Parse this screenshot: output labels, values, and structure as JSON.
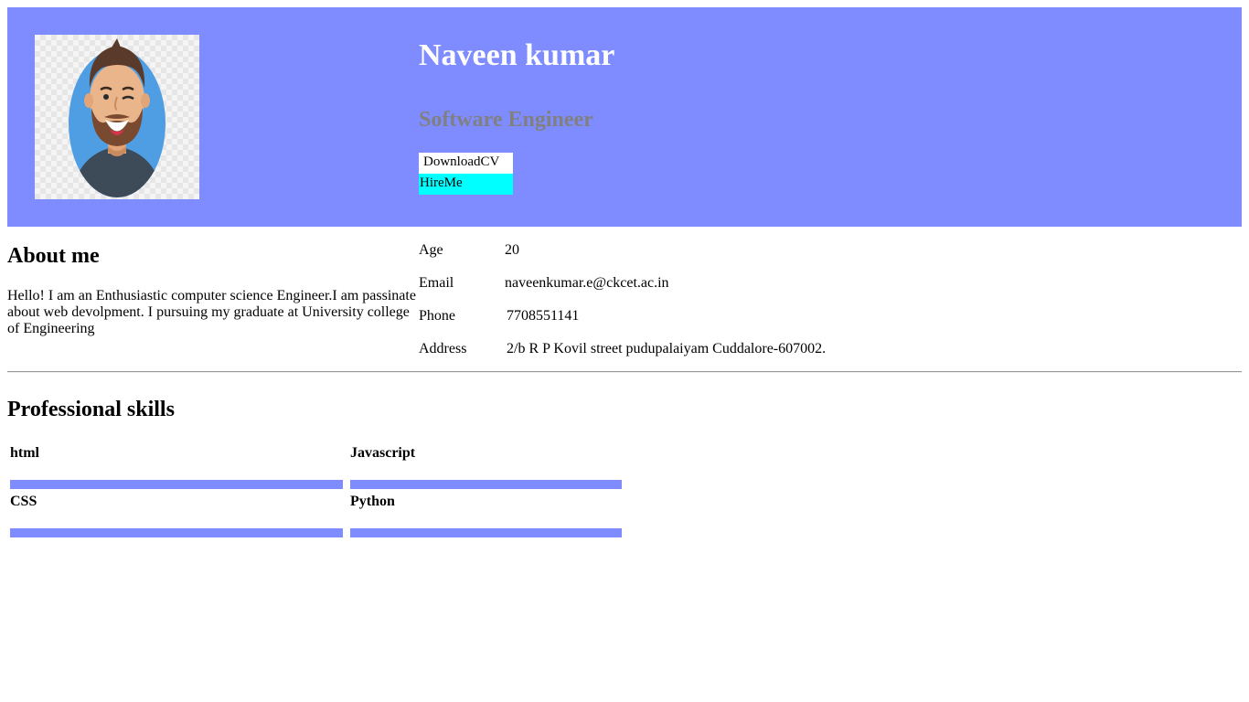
{
  "profile": {
    "name": "Naveen kumar",
    "role": "Software Engineer",
    "download_label": "DownloadCV",
    "hire_label": "HireMe"
  },
  "about": {
    "title": "About me",
    "text": "Hello! I am an Enthusiastic computer science Engineer.I am passinate about web devolpment. I pursuing my graduate at University college of Engineering"
  },
  "info": [
    {
      "label": "Age",
      "value": "20"
    },
    {
      "label": "Email",
      "value": "naveenkumar.e@ckcet.ac.in"
    },
    {
      "label": "Phone",
      "value": "7708551141"
    },
    {
      "label": "Address",
      "value": "2/b R P Kovil street pudupalaiyam Cuddalore-607002."
    }
  ],
  "skills": {
    "title": "Professional skills",
    "items": [
      {
        "name": "html",
        "level": 100
      },
      {
        "name": "Javascript",
        "level": 100
      },
      {
        "name": "CSS",
        "level": 100
      },
      {
        "name": "Python",
        "level": 100
      }
    ]
  },
  "colors": {
    "header_bg": "#7f8cff",
    "hire_bg": "#00ffff",
    "bar_fill": "#7f8cff"
  }
}
